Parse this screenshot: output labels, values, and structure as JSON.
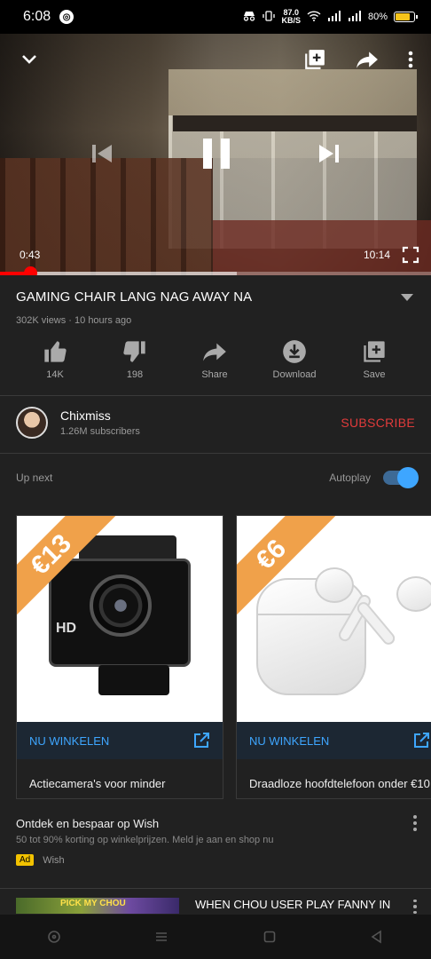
{
  "status_bar": {
    "time": "6:08",
    "net_speed_value": "87.0",
    "net_speed_unit": "KB/S",
    "battery": "80%"
  },
  "player": {
    "current_time": "0:43",
    "duration": "10:14",
    "progress_fraction": 0.07,
    "buffer_end_fraction": 0.55
  },
  "video": {
    "title": "GAMING CHAIR LANG NAG AWAY NA",
    "meta": "302K views · 10 hours ago"
  },
  "actions": [
    {
      "label": "14K",
      "icon": "thumbs-up-icon"
    },
    {
      "label": "198",
      "icon": "thumbs-down-icon"
    },
    {
      "label": "Share",
      "icon": "share-icon"
    },
    {
      "label": "Download",
      "icon": "download-icon"
    },
    {
      "label": "Save",
      "icon": "save-playlist-icon"
    }
  ],
  "channel": {
    "name": "Chixmiss",
    "subscribers": "1.26M subscribers",
    "subscribe_label": "SUBSCRIBE"
  },
  "up_next": {
    "label": "Up next",
    "autoplay_label": "Autoplay",
    "autoplay_on": true
  },
  "shopping_cards": [
    {
      "price": "€13",
      "cta": "NU WINKELEN",
      "description": "Actiecamera's voor minder"
    },
    {
      "price": "€6",
      "cta": "NU WINKELEN",
      "description": "Draadloze hoofdtelefoon onder €10"
    }
  ],
  "ad": {
    "title": "Ontdek en bespaar op Wish",
    "description": "50 tot 90% korting op winkelprijzen. Meld je aan en shop nu",
    "badge": "Ad",
    "advertiser": "Wish"
  },
  "next_video": {
    "thumb_text": "PICK MY CHOU",
    "title": "WHEN CHOU USER PLAY FANNY IN"
  },
  "colors": {
    "accent_red": "#ff0000",
    "subscribe_red": "#e13b3b",
    "link_blue": "#3ea6ff",
    "price_band": "#f0a14a",
    "ad_badge": "#f2c200"
  }
}
